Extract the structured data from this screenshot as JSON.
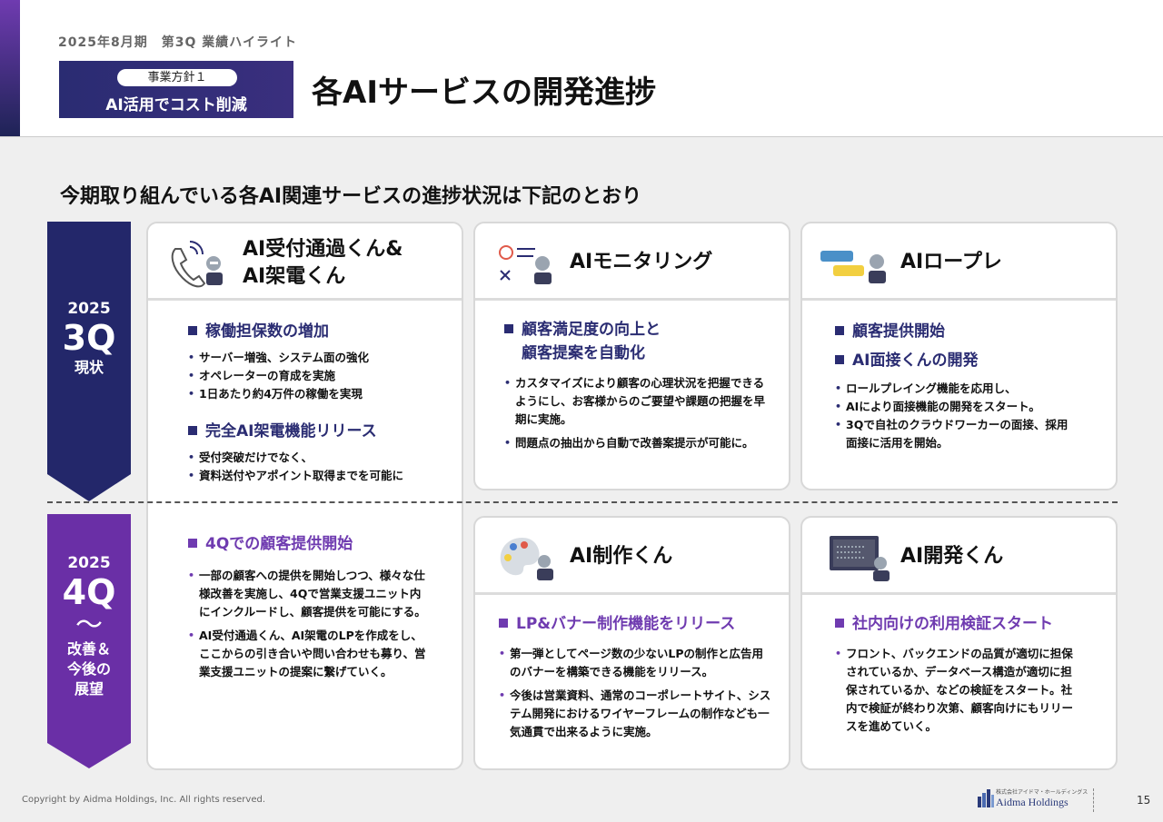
{
  "header": {
    "fiscal": "2025年8月期　第3Q 業績ハイライト",
    "policy_tag": "事業方針１",
    "policy_title": "AI活用でコスト削減",
    "title": "各AIサービスの開発進捗"
  },
  "lead": "今期取り組んでいる各AI関連サービスの進捗状況は下記のとおり",
  "timeline": {
    "q3": {
      "year": "2025",
      "quarter": "3Q",
      "label": "現状",
      "color": "#23276a"
    },
    "q4": {
      "year": "2025",
      "quarter": "4Q",
      "tilde": "〜",
      "label1": "改善＆",
      "label2": "今後の",
      "label3": "展望",
      "color": "#6a2fa6"
    }
  },
  "cards": {
    "call": {
      "title1": "AI受付通過くん&",
      "title2": "AI架電くん",
      "h1": "稼働担保数の増加",
      "b1": [
        "サーバー増強、システム面の強化",
        "オペレーターの育成を実施",
        "1日あたり約4万件の稼働を実現"
      ],
      "h2": "完全AI架電機能リリース",
      "b2": [
        "受付突破だけでなく、",
        "資料送付やアポイント取得までを可能に"
      ],
      "h3": "4Qでの顧客提供開始",
      "b3": [
        "一部の顧客への提供を開始しつつ、様々な仕様改善を実施し、4Qで営業支援ユニット内にインクルードし、顧客提供を可能にする。",
        "AI受付通過くん、AI架電のLPを作成をし、ここからの引き合いや問い合わせも募り、営業支援ユニットの提案に繋げていく。"
      ]
    },
    "monitor": {
      "title": "AIモニタリング",
      "h1a": "顧客満足度の向上と",
      "h1b": "顧客提案を自動化",
      "b1": [
        "カスタマイズにより顧客の心理状況を把握できるようにし、お客様からのご要望や課題の把握を早期に実施。",
        "問題点の抽出から自動で改善案提示が可能に。"
      ]
    },
    "roleplay": {
      "title": "AIロープレ",
      "h1": "顧客提供開始",
      "h2": "AI面接くんの開発",
      "b1": [
        "ロールプレイング機能を応用し、",
        "AIにより面接機能の開発をスタート。",
        "3Qで自社のクラウドワーカーの面接、採用面接に活用を開始。"
      ]
    },
    "create": {
      "title": "AI制作くん",
      "h1": "LP&バナー制作機能をリリース",
      "b1": [
        "第一弾としてページ数の少ないLPの制作と広告用のバナーを構築できる機能をリリース。",
        "今後は営業資料、通常のコーポレートサイト、システム開発におけるワイヤーフレームの制作なども一気通貫で出来るように実施。"
      ]
    },
    "dev": {
      "title": "AI開発くん",
      "h1": "社内向けの利用検証スタート",
      "b1": [
        "フロント、バックエンドの品質が適切に担保されているか、データベース構造が適切に担保されているか、などの検証をスタート。社内で検証が終わり次第、顧客向けにもリリースを進めていく。"
      ]
    }
  },
  "footer": {
    "copyright": "Copyright by Aidma Holdings, Inc. All rights reserved.",
    "logo_jp": "株式会社アイドマ・ホールディングス",
    "logo_en": "Aidma Holdings",
    "page": "15"
  }
}
